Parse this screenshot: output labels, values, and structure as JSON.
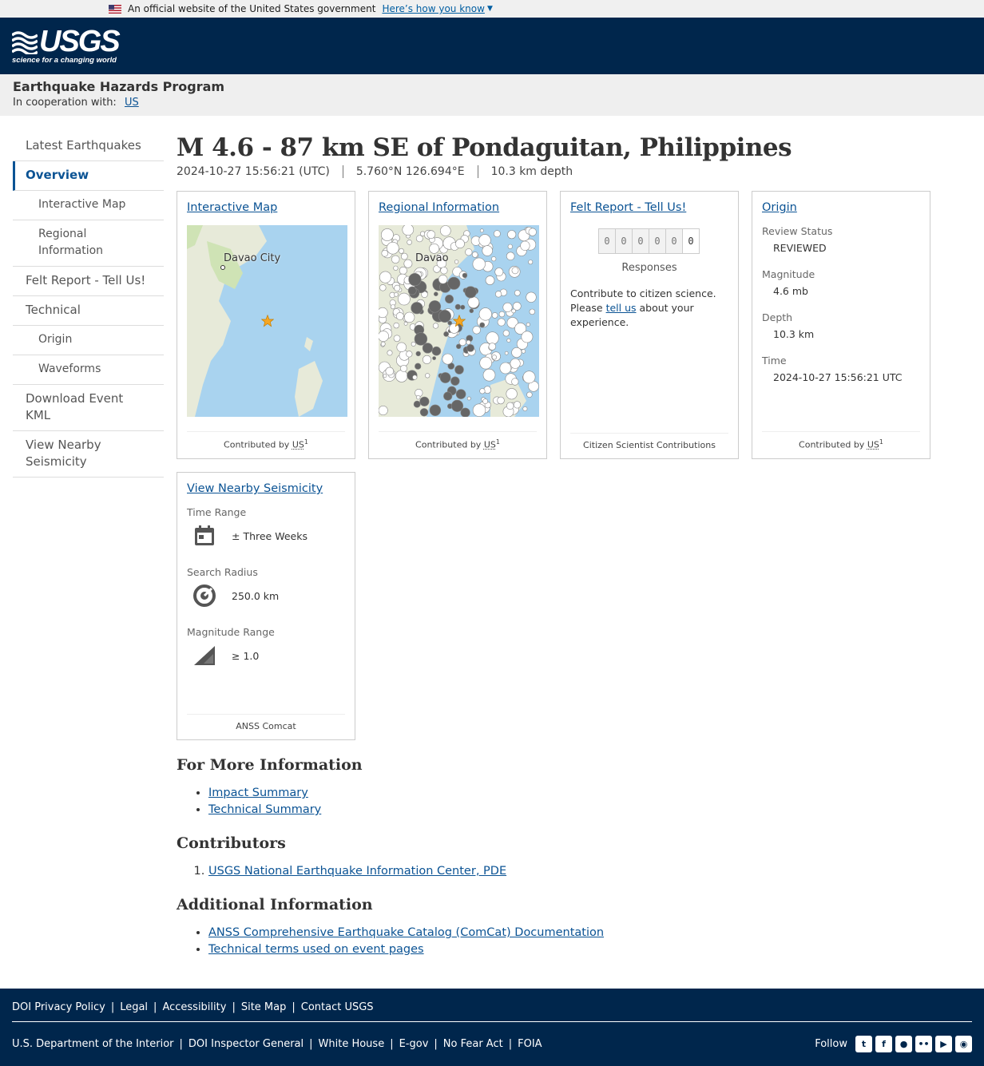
{
  "gov_banner": {
    "text": "An official website of the United States government",
    "link": "Here’s how you know"
  },
  "header": {
    "logo_text": "USGS",
    "tagline": "science for a changing world"
  },
  "program": {
    "title": "Earthquake Hazards Program",
    "coop_label": "In cooperation with:",
    "coop_link": "US"
  },
  "sidebar": {
    "items": [
      {
        "label": "Latest Earthquakes"
      },
      {
        "label": "Overview"
      },
      {
        "label": "Interactive Map"
      },
      {
        "label": "Regional Information"
      },
      {
        "label": "Felt Report - Tell Us!"
      },
      {
        "label": "Technical"
      },
      {
        "label": "Origin"
      },
      {
        "label": "Waveforms"
      },
      {
        "label": "Download Event KML"
      },
      {
        "label": "View Nearby Seismicity"
      }
    ]
  },
  "event": {
    "title": "M 4.6 - 87 km SE of Pondaguitan, Philippines",
    "time": "2024-10-27 15:56:21 (UTC)",
    "location": "5.760°N 126.694°E",
    "depth": "10.3 km depth"
  },
  "cards": {
    "map": {
      "title": "Interactive Map",
      "label": "Davao City",
      "foot_prefix": "Contributed by",
      "foot_abbr": "US",
      "foot_sup": "1"
    },
    "regional": {
      "title": "Regional Information",
      "label": "Davao",
      "foot_prefix": "Contributed by",
      "foot_abbr": "US",
      "foot_sup": "1"
    },
    "felt": {
      "title": "Felt Report - Tell Us!",
      "digits": [
        "0",
        "0",
        "0",
        "0",
        "0",
        "0"
      ],
      "responses": "Responses",
      "text_before": "Contribute to citizen science. Please",
      "link": "tell us",
      "text_after": "about your experience.",
      "foot": "Citizen Scientist Contributions"
    },
    "origin": {
      "title": "Origin",
      "review_label": "Review Status",
      "review_value": "REVIEWED",
      "mag_label": "Magnitude",
      "mag_value": "4.6 mb",
      "depth_label": "Depth",
      "depth_value": "10.3 km",
      "time_label": "Time",
      "time_value": "2024-10-27 15:56:21 UTC",
      "foot_prefix": "Contributed by",
      "foot_abbr": "US",
      "foot_sup": "1"
    },
    "seismicity": {
      "title": "View Nearby Seismicity",
      "time_label": "Time Range",
      "time_value": "± Three Weeks",
      "radius_label": "Search Radius",
      "radius_value": "250.0 km",
      "mag_label": "Magnitude Range",
      "mag_value": "≥ 1.0",
      "foot": "ANSS Comcat"
    }
  },
  "more_info": {
    "heading": "For More Information",
    "links": [
      "Impact Summary",
      "Technical Summary"
    ]
  },
  "contributors": {
    "heading": "Contributors",
    "links": [
      "USGS National Earthquake Information Center, PDE"
    ]
  },
  "additional": {
    "heading": "Additional Information",
    "links": [
      "ANSS Comprehensive Earthquake Catalog (ComCat) Documentation",
      "Technical terms used on event pages"
    ]
  },
  "footer": {
    "row1": [
      "DOI Privacy Policy",
      "Legal",
      "Accessibility",
      "Site Map",
      "Contact USGS"
    ],
    "row2": [
      "U.S. Department of the Interior",
      "DOI Inspector General",
      "White House",
      "E-gov",
      "No Fear Act",
      "FOIA"
    ],
    "follow": "Follow",
    "social_icons": [
      "twitter-icon",
      "facebook-icon",
      "github-icon",
      "flickr-icon",
      "youtube-icon",
      "instagram-icon"
    ]
  },
  "colors": {
    "header_bg": "#00264c",
    "link": "#0b5394",
    "star": "#f5a623"
  }
}
